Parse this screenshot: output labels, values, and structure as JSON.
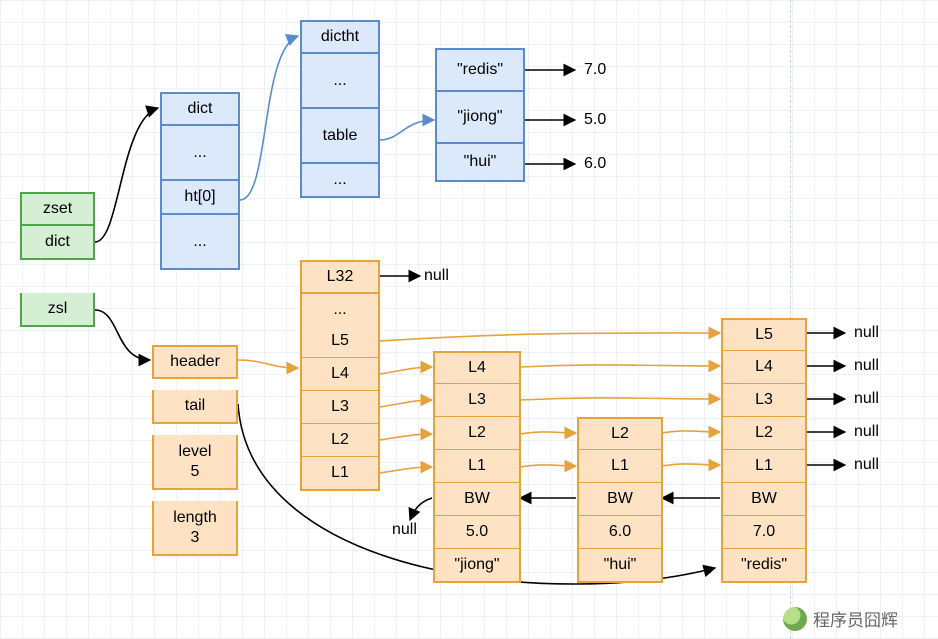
{
  "zset": {
    "title": "zset",
    "dict": "dict",
    "zsl": "zsl"
  },
  "dict_struct": {
    "type": "dict",
    "dots": "...",
    "slot": "ht[0]",
    "dots2": "..."
  },
  "dictht": {
    "type": "dictht",
    "dots": "...",
    "table": "table",
    "dots2": "..."
  },
  "entries": [
    {
      "key": "\"redis\"",
      "val": "7.0"
    },
    {
      "key": "\"jiong\"",
      "val": "5.0"
    },
    {
      "key": "\"hui\"",
      "val": "6.0"
    }
  ],
  "zsl": {
    "header": "header",
    "tail": "tail",
    "level_label": "level",
    "level_value": "5",
    "length_label": "length",
    "length_value": "3"
  },
  "skiplist": {
    "header_levels": [
      "L32",
      "...",
      "L5",
      "L4",
      "L3",
      "L2",
      "L1"
    ],
    "nodes": [
      {
        "levels": [
          "L4",
          "L3",
          "L2",
          "L1"
        ],
        "bw": "BW",
        "score": "5.0",
        "key": "\"jiong\""
      },
      {
        "levels": [
          "L2",
          "L1"
        ],
        "bw": "BW",
        "score": "6.0",
        "key": "\"hui\""
      },
      {
        "levels": [
          "L5",
          "L4",
          "L3",
          "L2",
          "L1"
        ],
        "bw": "BW",
        "score": "7.0",
        "key": "\"redis\""
      }
    ],
    "null": "null"
  },
  "watermark": "程序员囧辉"
}
